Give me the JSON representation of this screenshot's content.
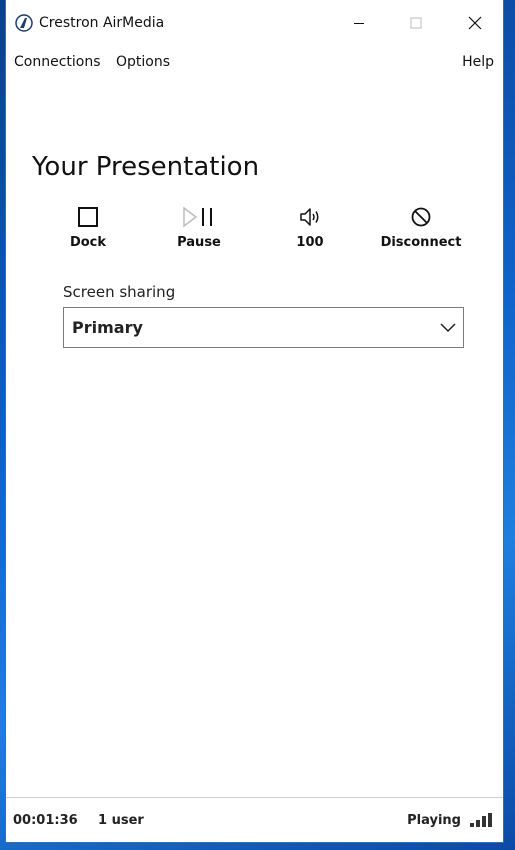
{
  "window": {
    "title": "Crestron AirMedia",
    "controls": {
      "minimize": "minimize-icon",
      "maximize": "maximize-icon",
      "close": "close-icon"
    }
  },
  "menu": {
    "connections": "Connections",
    "options": "Options",
    "help": "Help"
  },
  "main": {
    "heading": "Your Presentation",
    "controls": [
      {
        "label": "Dock",
        "icon": "dock-square-icon"
      },
      {
        "label": "Pause",
        "icon": "play-pause-icon"
      },
      {
        "label": "100",
        "icon": "volume-icon"
      },
      {
        "label": "Disconnect",
        "icon": "disconnect-icon"
      }
    ],
    "screen_sharing": {
      "label": "Screen sharing",
      "selected": "Primary"
    }
  },
  "status": {
    "elapsed": "00:01:36",
    "users": "1 user",
    "state": "Playing",
    "signal_icon": "signal-strength-icon"
  },
  "colors": {
    "desktop": "#0f62c9",
    "window_bg": "#ffffff",
    "text": "#111111"
  }
}
